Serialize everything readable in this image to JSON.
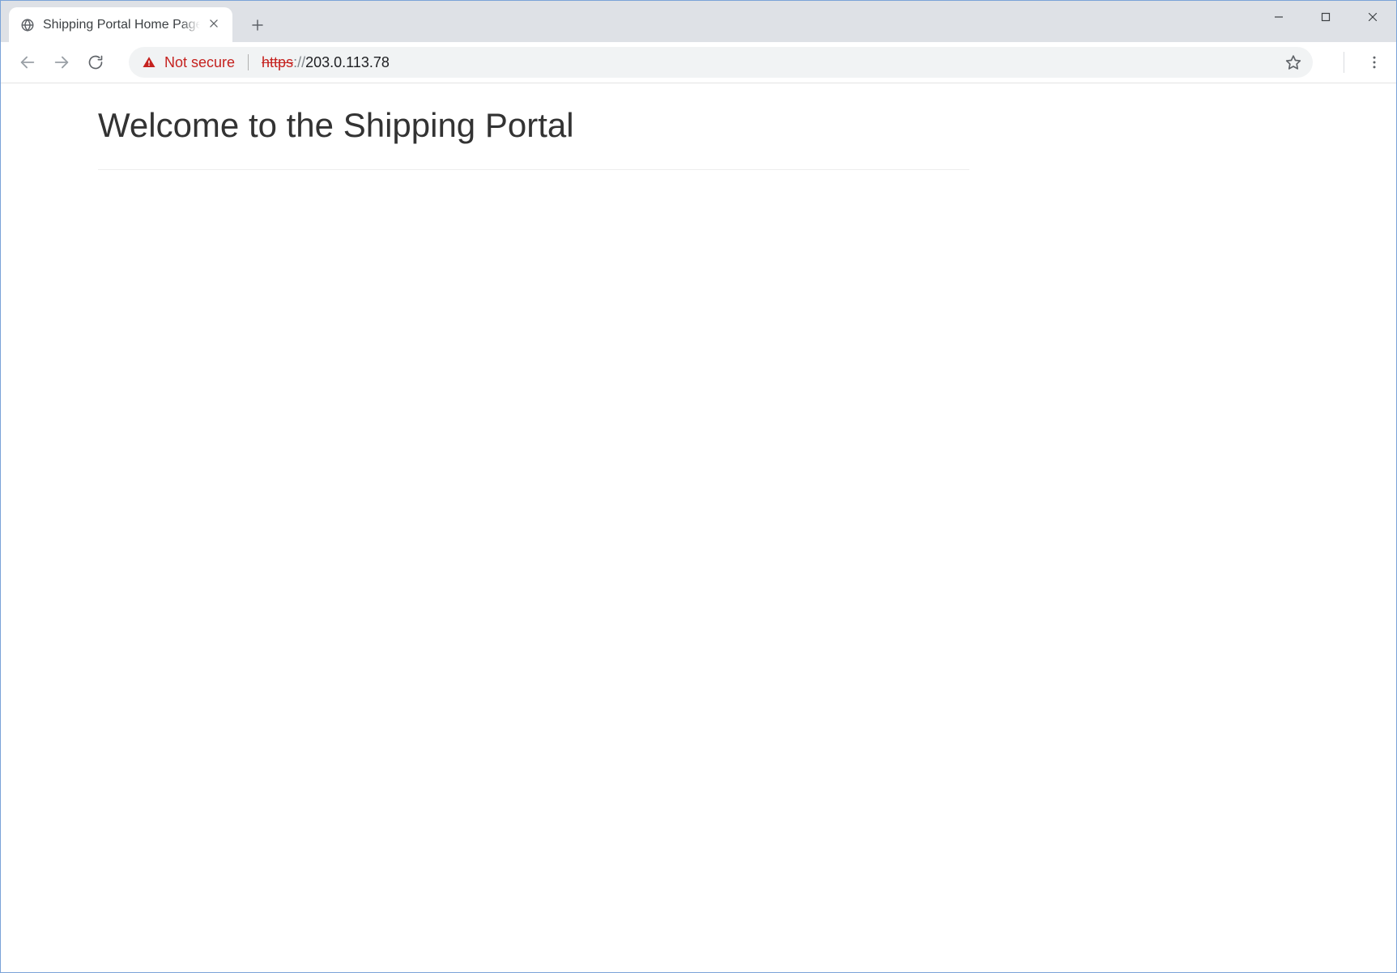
{
  "tab": {
    "title": "Shipping Portal Home Page - Shi"
  },
  "security": {
    "label": "Not secure"
  },
  "url": {
    "scheme": "https",
    "scheme_sep": "://",
    "host": "203.0.113.78"
  },
  "page": {
    "heading": "Welcome to the Shipping Portal"
  }
}
